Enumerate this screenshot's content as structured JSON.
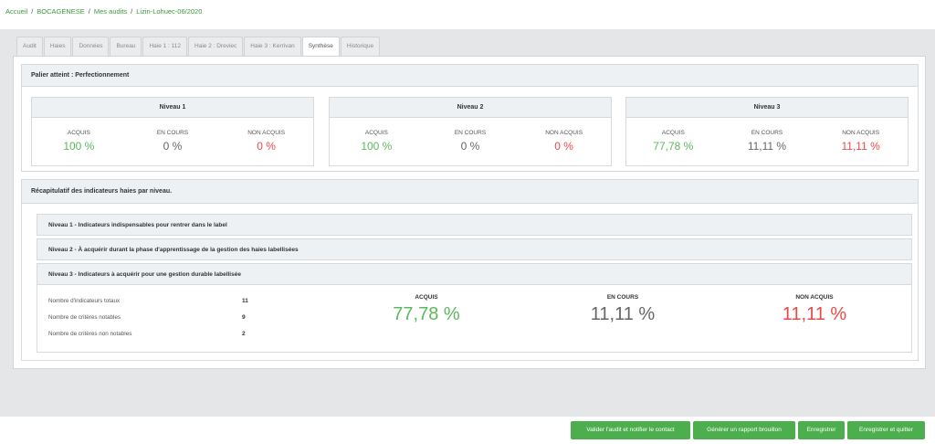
{
  "breadcrumb": [
    "Accueil",
    "BOCAGENESE",
    "Mes audits",
    "Lizin-Lohuec-06/2020"
  ],
  "tabs": [
    {
      "label": "Audit",
      "active": false
    },
    {
      "label": "Haies",
      "active": false
    },
    {
      "label": "Données",
      "active": false
    },
    {
      "label": "Bureau",
      "active": false
    },
    {
      "label": "Haie 1 : 112",
      "active": false
    },
    {
      "label": "Haie 2 : Dreviec",
      "active": false
    },
    {
      "label": "Haie 3 : Kerrivan",
      "active": false
    },
    {
      "label": "Synthèse",
      "active": true
    },
    {
      "label": "Historique",
      "active": false
    }
  ],
  "palier": {
    "title": "Palier atteint : Perfectionnement",
    "niveaux": [
      {
        "title": "Niveau 1",
        "acquis": "100 %",
        "en_cours": "0 %",
        "non_acquis": "0 %"
      },
      {
        "title": "Niveau 2",
        "acquis": "100 %",
        "en_cours": "0 %",
        "non_acquis": "0 %"
      },
      {
        "title": "Niveau 3",
        "acquis": "77,78 %",
        "en_cours": "11,11 %",
        "non_acquis": "11,11 %"
      }
    ],
    "labels": {
      "acquis": "ACQUIS",
      "en_cours": "EN COURS",
      "non_acquis": "NON ACQUIS"
    }
  },
  "recap": {
    "title": "Récapitulatif des indicateurs haies par niveau.",
    "sections": [
      "Niveau 1 - Indicateurs indispensables pour rentrer dans le label",
      "Niveau 2 - À acquérir durant la phase d'apprentissage de la gestion des haies labellisées",
      "Niveau 3 - Indicateurs à acquérir pour une gestion durable labellisée"
    ],
    "stats": [
      {
        "label": "Nombre d'indicateurs totaux",
        "value": "11"
      },
      {
        "label": "Nombre de critères notables",
        "value": "9"
      },
      {
        "label": "Nombre de critères non notables",
        "value": "2"
      }
    ],
    "big": {
      "acquis": "77,78 %",
      "en_cours": "11,11 %",
      "non_acquis": "11,11 %"
    }
  },
  "buttons": {
    "valider": "Valider l'audit et notifier le contact",
    "rapport": "Générer un rapport brouillon",
    "enregistrer": "Enregistrer",
    "enregistrer_quitter": "Enregistrer et quitter"
  },
  "colors": {
    "accent_green": "#4cae4c",
    "acquis": "#5cb85c",
    "non_acquis": "#e84a4a"
  }
}
